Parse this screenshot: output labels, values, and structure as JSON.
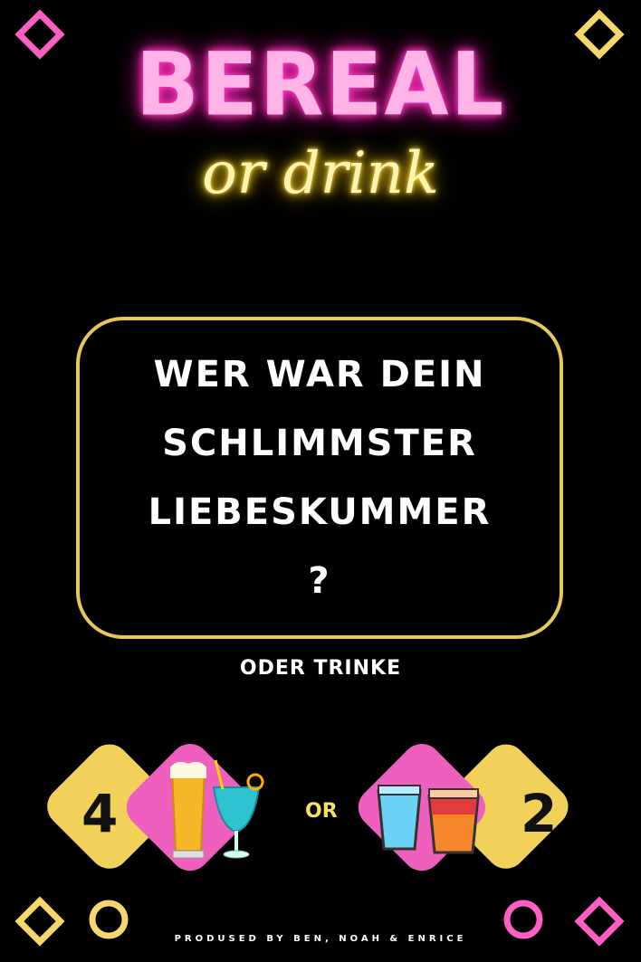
{
  "title": {
    "main": "BEREAL",
    "sub": "or drink"
  },
  "question": {
    "lines": [
      "WER WAR DEIN",
      "SCHLIMMSTER",
      "LIEBESKUMMER",
      "?"
    ]
  },
  "subline": "ODER TRINKE",
  "option_left": {
    "count": "4",
    "icons": [
      "beer-glass-icon",
      "cocktail-glass-icon"
    ]
  },
  "or_label": "OR",
  "option_right": {
    "count": "2",
    "icons": [
      "blue-shot-icon",
      "orange-shot-icon"
    ]
  },
  "credit": "PRODUSED BY BEN, NOAH & ENRICE",
  "colors": {
    "pink": "#ff5fc4",
    "yellow": "#f2d15a",
    "box_border": "#e6c75a",
    "background": "#000000"
  }
}
